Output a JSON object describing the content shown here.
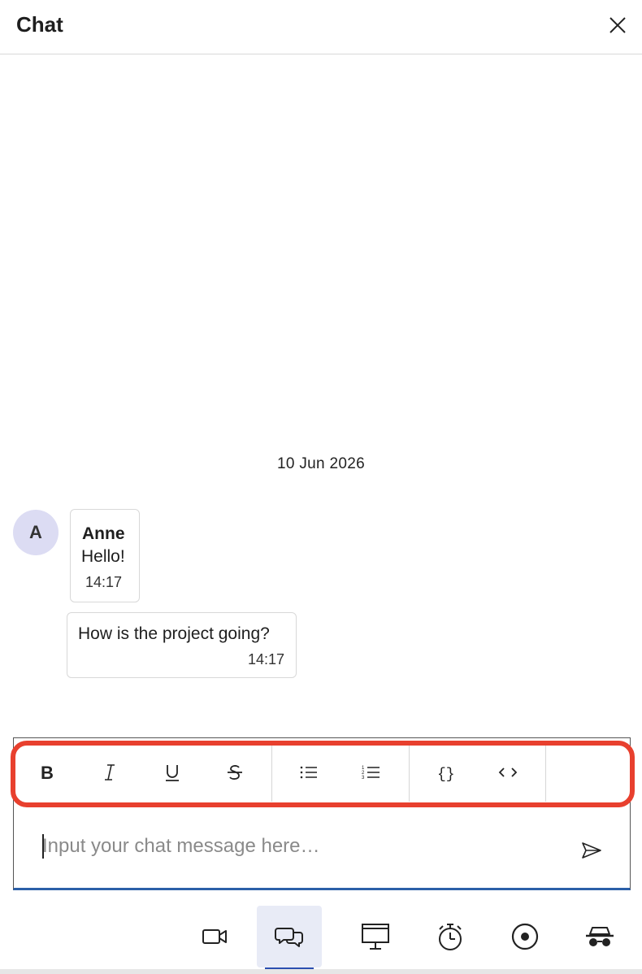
{
  "header": {
    "title": "Chat",
    "close_icon": "close-icon"
  },
  "messages": {
    "date_divider": "10 Jun 2026",
    "avatar_initial": "A",
    "items": [
      {
        "sender": "Anne",
        "text": "Hello!",
        "time": "14:17"
      },
      {
        "text": "How is the project going?",
        "time": "14:17"
      }
    ]
  },
  "toolbar": {
    "highlight_color": "#e8402e",
    "tools": [
      {
        "name": "bold",
        "icon": "bold-icon"
      },
      {
        "name": "italic",
        "icon": "italic-icon"
      },
      {
        "name": "underline",
        "icon": "underline-icon"
      },
      {
        "name": "strikethrough",
        "icon": "strikethrough-icon"
      },
      {
        "name": "bulleted-list",
        "icon": "bulleted-list-icon"
      },
      {
        "name": "numbered-list",
        "icon": "numbered-list-icon"
      },
      {
        "name": "code-block",
        "icon": "code-block-icon"
      },
      {
        "name": "inline-code",
        "icon": "inline-code-icon"
      }
    ]
  },
  "composer": {
    "placeholder": "Input your chat message here…",
    "value": "",
    "send_icon": "send-icon",
    "focus_color": "#2b5fa8"
  },
  "bottom_nav": {
    "active": "chat",
    "accent_color": "#2b4fb0",
    "items": [
      {
        "name": "video",
        "icon": "video-camera-icon"
      },
      {
        "name": "chat",
        "icon": "chat-bubbles-icon"
      },
      {
        "name": "presentation",
        "icon": "presentation-board-icon"
      },
      {
        "name": "timer",
        "icon": "stopwatch-icon"
      },
      {
        "name": "record",
        "icon": "record-icon"
      },
      {
        "name": "incognito",
        "icon": "incognito-icon"
      }
    ]
  }
}
